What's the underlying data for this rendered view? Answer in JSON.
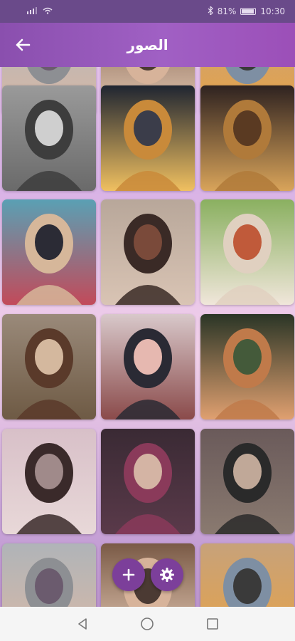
{
  "status_bar": {
    "battery_percent": "81%",
    "time": "10:30"
  },
  "app_bar": {
    "title": "الصور",
    "back_icon": "arrow-left-icon"
  },
  "gallery": {
    "photos": [
      {
        "palette": [
          "#b0b4b8",
          "#8d8f93",
          "#6b5b6e",
          "#d9b9a6"
        ]
      },
      {
        "palette": [
          "#7a5a46",
          "#d7b39a",
          "#4b3a33",
          "#e8cdb8"
        ]
      },
      {
        "palette": [
          "#c7a27a",
          "#7e8fa3",
          "#3a3a3a",
          "#e7a347"
        ]
      },
      {
        "palette": [
          "#9a9a9a",
          "#3d3d3d",
          "#cfcfcf",
          "#6a6a6a"
        ]
      },
      {
        "palette": [
          "#1f2531",
          "#c98a3a",
          "#3b3d4a",
          "#f0c060"
        ]
      },
      {
        "palette": [
          "#2e2220",
          "#b07a3a",
          "#5a3a22",
          "#d9a45a"
        ]
      },
      {
        "palette": [
          "#5aa0b4",
          "#d6b79a",
          "#2b2b35",
          "#c24a5a"
        ]
      },
      {
        "palette": [
          "#b8a79a",
          "#3a2a26",
          "#7a4a3a",
          "#d9c4b4"
        ]
      },
      {
        "palette": [
          "#8ab060",
          "#e0d0c0",
          "#c05a3a",
          "#f0e6da"
        ]
      },
      {
        "palette": [
          "#9a8a7a",
          "#5a3a2a",
          "#d4b89e",
          "#6e5a44"
        ]
      },
      {
        "palette": [
          "#d8c8ca",
          "#2a2a34",
          "#e6b8b0",
          "#8a4a4a"
        ]
      },
      {
        "palette": [
          "#2a3526",
          "#c07a4a",
          "#445a3a",
          "#e0a070"
        ]
      },
      {
        "palette": [
          "#d8c0c8",
          "#3a2a2a",
          "#a08a8a",
          "#e8d8d8"
        ]
      },
      {
        "palette": [
          "#3a2a34",
          "#8a3a5a",
          "#d4b4a4",
          "#5a3a4a"
        ]
      },
      {
        "palette": [
          "#6a5a5a",
          "#2a2a2a",
          "#c0a898",
          "#8a7a70"
        ]
      }
    ]
  },
  "actions": {
    "add_icon": "plus-icon",
    "settings_icon": "gear-icon"
  },
  "nav": {
    "back_icon": "triangle-back-icon",
    "home_icon": "circle-home-icon",
    "recents_icon": "square-recents-icon"
  }
}
